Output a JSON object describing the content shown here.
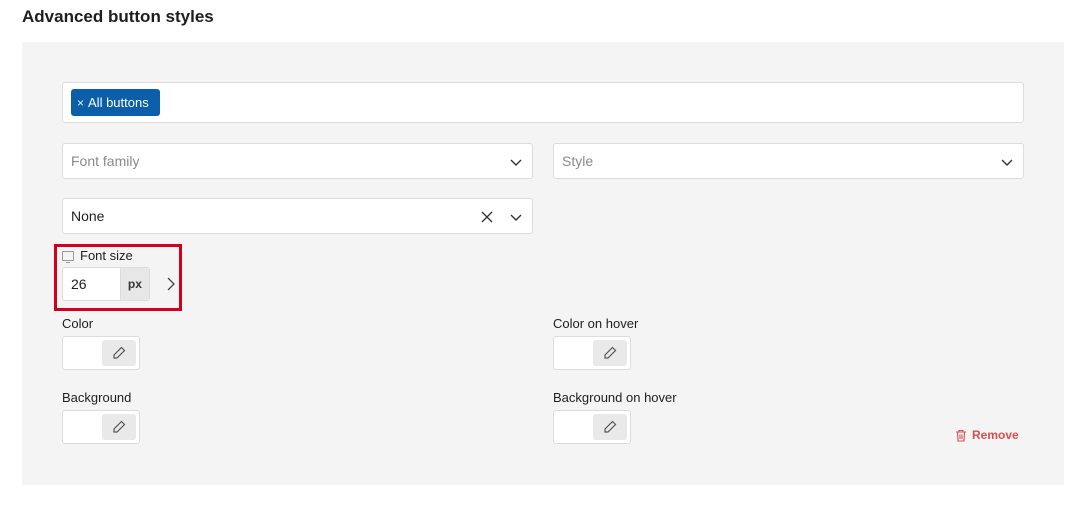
{
  "section": {
    "title": "Advanced button styles"
  },
  "selector": {
    "tags": [
      {
        "label": "All buttons",
        "remove_glyph": "×"
      }
    ]
  },
  "font_family": {
    "placeholder": "Font family"
  },
  "style_select": {
    "placeholder": "Style"
  },
  "transform_select": {
    "value": "None"
  },
  "font_size": {
    "label": "Font size",
    "value": "26",
    "unit": "px"
  },
  "color": {
    "label": "Color"
  },
  "color_hover": {
    "label": "Color on hover"
  },
  "background": {
    "label": "Background"
  },
  "background_hover": {
    "label": "Background on hover"
  },
  "remove": {
    "label": "Remove"
  },
  "colors": {
    "accent": "#0a5fa8",
    "danger": "#d94f4f",
    "highlight": "#d0021b",
    "panel": "#f4f4f4"
  },
  "icons": [
    "chevron-down-icon",
    "close-icon",
    "monitor-icon",
    "chevron-right-icon",
    "eyedropper-icon",
    "trash-icon"
  ]
}
